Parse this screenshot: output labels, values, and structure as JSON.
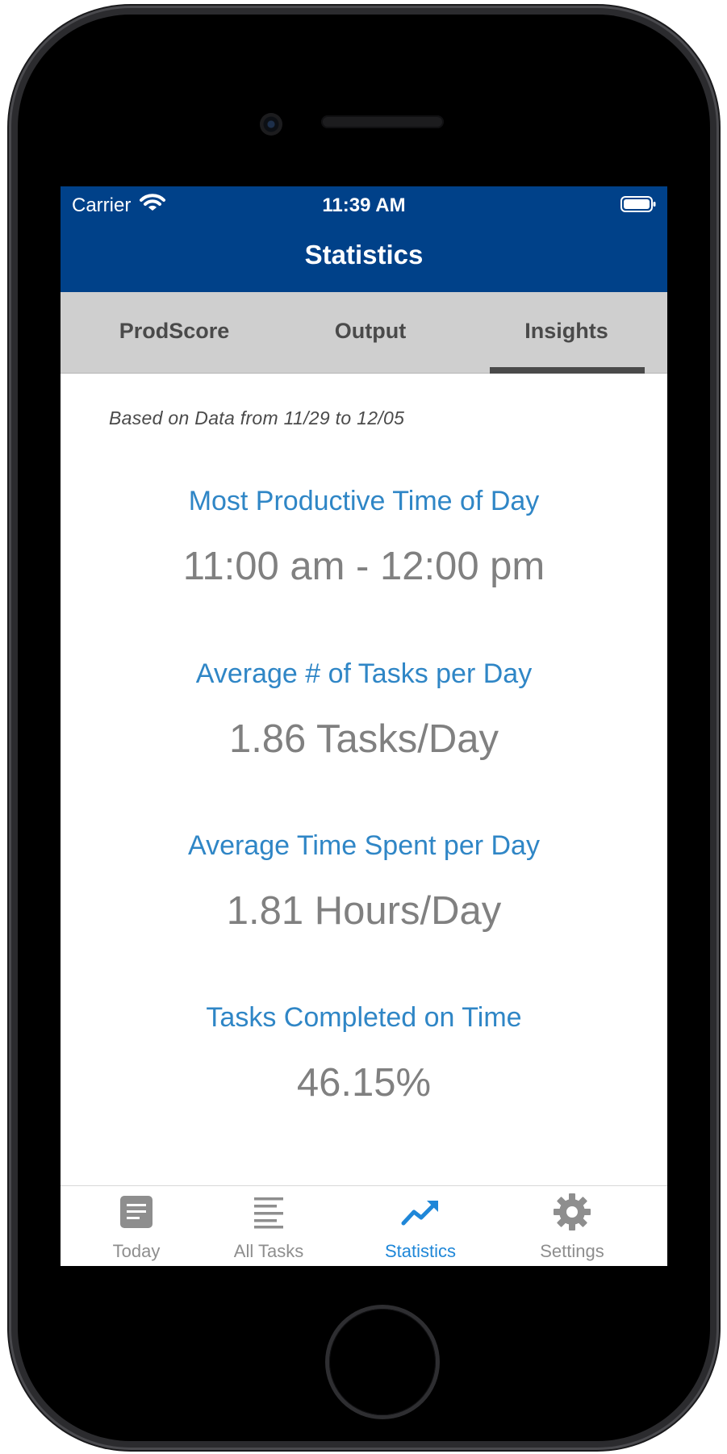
{
  "status_bar": {
    "carrier": "Carrier",
    "time": "11:39 AM"
  },
  "nav": {
    "title": "Statistics"
  },
  "segments": [
    {
      "label": "ProdScore",
      "selected": false
    },
    {
      "label": "Output",
      "selected": false
    },
    {
      "label": "Insights",
      "selected": true
    }
  ],
  "insights": {
    "date_range_text": "Based on Data from 11/29 to 12/05",
    "stats": [
      {
        "label": "Most Productive Time of Day",
        "value": "11:00 am - 12:00 pm"
      },
      {
        "label": "Average # of Tasks per Day",
        "value": "1.86 Tasks/Day"
      },
      {
        "label": "Average Time Spent per Day",
        "value": "1.81 Hours/Day"
      },
      {
        "label": "Tasks Completed on Time",
        "value": "46.15%"
      }
    ]
  },
  "tab_bar": {
    "items": [
      {
        "label": "Today",
        "icon": "document-icon",
        "active": false
      },
      {
        "label": "All Tasks",
        "icon": "list-icon",
        "active": false
      },
      {
        "label": "Statistics",
        "icon": "trending-up-icon",
        "active": true
      },
      {
        "label": "Settings",
        "icon": "gear-icon",
        "active": false
      }
    ]
  },
  "colors": {
    "nav_background": "#004189",
    "accent_blue": "#2f86c6",
    "tab_active": "#1f87d8",
    "tab_inactive": "#8e8e8e",
    "segment_background": "#cfcfcf",
    "value_gray": "#808080"
  }
}
